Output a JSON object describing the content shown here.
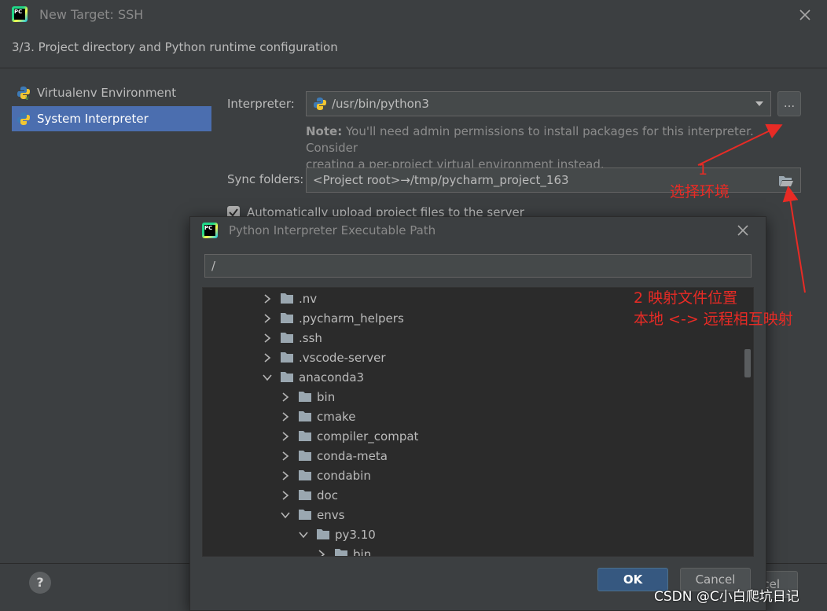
{
  "window": {
    "title": "New Target: SSH",
    "step": "3/3. Project directory and Python runtime configuration",
    "logo_text": "PC"
  },
  "sidebar": {
    "items": [
      {
        "label": "Virtualenv Environment",
        "selected": false
      },
      {
        "label": "System Interpreter",
        "selected": true
      }
    ]
  },
  "form": {
    "interpreter_label": "Interpreter:",
    "interpreter_value": "/usr/bin/python3",
    "browse_label": "...",
    "note_bold": "Note:",
    "note_line1": " You'll need admin permissions to install packages for this interpreter. Consider",
    "note_line2": "creating a per-project virtual environment instead.",
    "sync_label": "Sync folders:",
    "sync_value": "<Project root>→/tmp/pycharm_project_163",
    "auto_upload_label": "Automatically upload project files to the server",
    "auto_upload_checked": true
  },
  "main_buttons": {
    "help": "?",
    "cancel_partial": "cel"
  },
  "dialog": {
    "title": "Python Interpreter Executable Path",
    "path_value": "/",
    "tree": [
      {
        "label": ".nv",
        "level": 0,
        "expanded": false
      },
      {
        "label": ".pycharm_helpers",
        "level": 0,
        "expanded": false
      },
      {
        "label": ".ssh",
        "level": 0,
        "expanded": false
      },
      {
        "label": ".vscode-server",
        "level": 0,
        "expanded": false
      },
      {
        "label": "anaconda3",
        "level": 0,
        "expanded": true
      },
      {
        "label": "bin",
        "level": 1,
        "expanded": false
      },
      {
        "label": "cmake",
        "level": 1,
        "expanded": false
      },
      {
        "label": "compiler_compat",
        "level": 1,
        "expanded": false
      },
      {
        "label": "conda-meta",
        "level": 1,
        "expanded": false
      },
      {
        "label": "condabin",
        "level": 1,
        "expanded": false
      },
      {
        "label": "doc",
        "level": 1,
        "expanded": false
      },
      {
        "label": "envs",
        "level": 1,
        "expanded": true
      },
      {
        "label": "py3.10",
        "level": 2,
        "expanded": true
      },
      {
        "label": "bin",
        "level": 3,
        "expanded": false
      }
    ],
    "ok_label": "OK",
    "cancel_label": "Cancel"
  },
  "annotations": {
    "a1_num": "1",
    "a1_text": "选择环境",
    "a2_line1": "2 映射文件位置",
    "a2_line2": "本地 <-> 远程相互映射",
    "color": "#e82b25"
  },
  "watermark": "CSDN @C小白爬坑日记",
  "colors": {
    "background": "#3c3f41",
    "selection": "#4b6eaf",
    "ok_button": "#365880",
    "tree_bg": "#2b2b2b"
  }
}
